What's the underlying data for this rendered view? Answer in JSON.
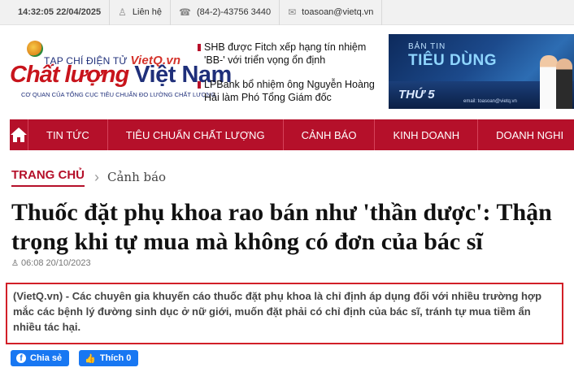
{
  "topbar": {
    "datetime": "14:32:05 22/04/2025",
    "contact_label": "Liên hệ",
    "phone": "(84-2)-43756 3440",
    "email": "toasoan@vietq.vn"
  },
  "logo": {
    "line1": "TẠP CHÍ ĐIỆN TỬ",
    "line1_brand": "VietQ.vn",
    "line2_a": "Chất lượng",
    "line2_b": "Việt Nam",
    "line3": "CƠ QUAN CỦA TỔNG CỤC TIÊU CHUẨN ĐO LƯỜNG CHẤT LƯỢNG"
  },
  "headlines": [
    "SHB được Fitch xếp hạng tín nhiệm 'BB-' với triển vọng ổn định",
    "LPBank bổ nhiệm ông Nguyễn Hoàng Hải làm Phó Tổng Giám đốc"
  ],
  "banner": {
    "line1": "BẢN TIN",
    "line2": "TIÊU DÙNG",
    "line3": "THỨ 5",
    "small": "email: toasoan@vietq.vn"
  },
  "nav": {
    "items": [
      "TIN TỨC",
      "TIÊU CHUẨN CHẤT LƯỢNG",
      "CẢNH BÁO",
      "KINH DOANH",
      "DOANH NGHI"
    ]
  },
  "breadcrumb": {
    "home": "TRANG CHỦ",
    "current": "Cảnh báo"
  },
  "article": {
    "title": "Thuốc đặt phụ khoa rao bán như 'thần dược': Thận trọng khi tự mua mà không có đơn của bác sĩ",
    "date": "06:08 20/10/2023",
    "sapo": "(VietQ.vn) - Các chuyên gia khuyến cáo thuốc đặt phụ khoa là chỉ định áp dụng đối với nhiều trường hợp mắc các bệnh lý đường sinh dục ở nữ giới, muốn đặt phải có chỉ định của bác sĩ, tránh tự mua tiềm ẩn nhiều tác hại."
  },
  "share": {
    "share_label": "Chia sẻ",
    "like_label": "Thích 0"
  },
  "colors": {
    "brand_red": "#b5102a",
    "highlight_border": "#d21f28",
    "facebook_blue": "#1877f2"
  }
}
